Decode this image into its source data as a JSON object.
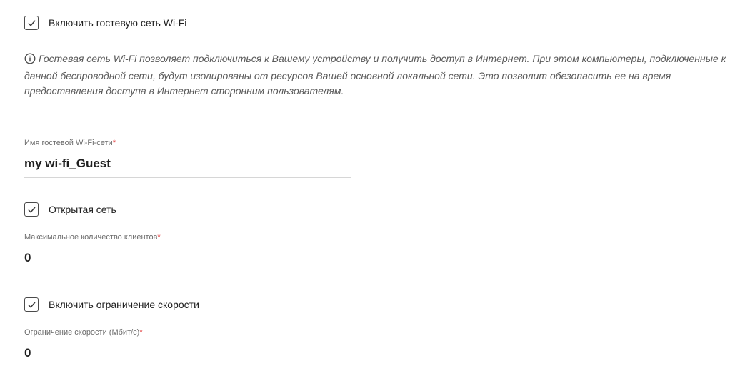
{
  "guest_wifi": {
    "enable_label": "Включить гостевую сеть Wi-Fi",
    "enable_checked": true,
    "info_text": "Гостевая сеть Wi-Fi позволяет подключиться к Вашему устройству и получить доступ в Интернет. При этом компьютеры, подключенные к данной беспроводной сети, будут изолированы от ресурсов Вашей основной локальной сети. Это позволит обезопасить ее на время предоставления доступа в Интернет сторонним пользователям.",
    "info_icon": "info-circle-icon",
    "ssid": {
      "label": "Имя гостевой Wi-Fi-сети",
      "required_mark": "*",
      "value": "my wi-fi_Guest"
    },
    "open_network": {
      "label": "Открытая сеть",
      "checked": true
    },
    "max_clients": {
      "label": "Максимальное количество клиентов",
      "required_mark": "*",
      "value": "0"
    },
    "speed_limit_enable": {
      "label": "Включить ограничение скорости",
      "checked": true
    },
    "speed_limit": {
      "label": "Ограничение скорости (Мбит/с)",
      "required_mark": "*",
      "value": "0"
    }
  },
  "colors": {
    "required": "#e03030",
    "text": "#202020",
    "muted": "#6a6a6a",
    "underline": "#d6d6d6"
  }
}
